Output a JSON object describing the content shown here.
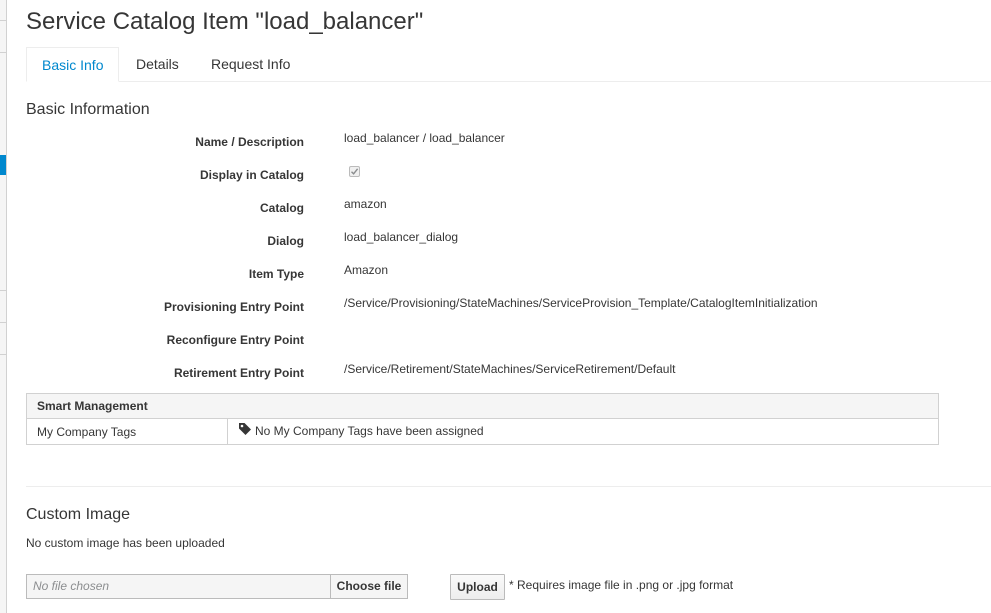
{
  "page": {
    "title": "Service Catalog Item \"load_balancer\""
  },
  "tabs": [
    {
      "label": "Basic Info",
      "active": true
    },
    {
      "label": "Details",
      "active": false
    },
    {
      "label": "Request Info",
      "active": false
    }
  ],
  "basic_info": {
    "section_title": "Basic Information",
    "fields": [
      {
        "label": "Name / Description",
        "value": "load_balancer / load_balancer"
      },
      {
        "label": "Display in Catalog",
        "checked": true
      },
      {
        "label": "Catalog",
        "value": "amazon"
      },
      {
        "label": "Dialog",
        "value": "load_balancer_dialog"
      },
      {
        "label": "Item Type",
        "value": "Amazon"
      },
      {
        "label": "Provisioning Entry Point",
        "value": "/Service/Provisioning/StateMachines/ServiceProvision_Template/CatalogItemInitialization"
      },
      {
        "label": "Reconfigure Entry Point",
        "value": ""
      },
      {
        "label": "Retirement Entry Point",
        "value": "/Service/Retirement/StateMachines/ServiceRetirement/Default"
      }
    ]
  },
  "smart_management": {
    "header": "Smart Management",
    "row_label": "My Company Tags",
    "row_value": "No My Company Tags have been assigned",
    "icon": "tag-icon"
  },
  "custom_image": {
    "section_title": "Custom Image",
    "status": "No custom image has been uploaded",
    "file_placeholder": "No file chosen",
    "choose_label": "Choose file",
    "upload_label": "Upload",
    "note": "* Requires image file in .png or .jpg format"
  },
  "colors": {
    "accent": "#0088ce",
    "text": "#363636",
    "border": "#d1d1d1"
  }
}
